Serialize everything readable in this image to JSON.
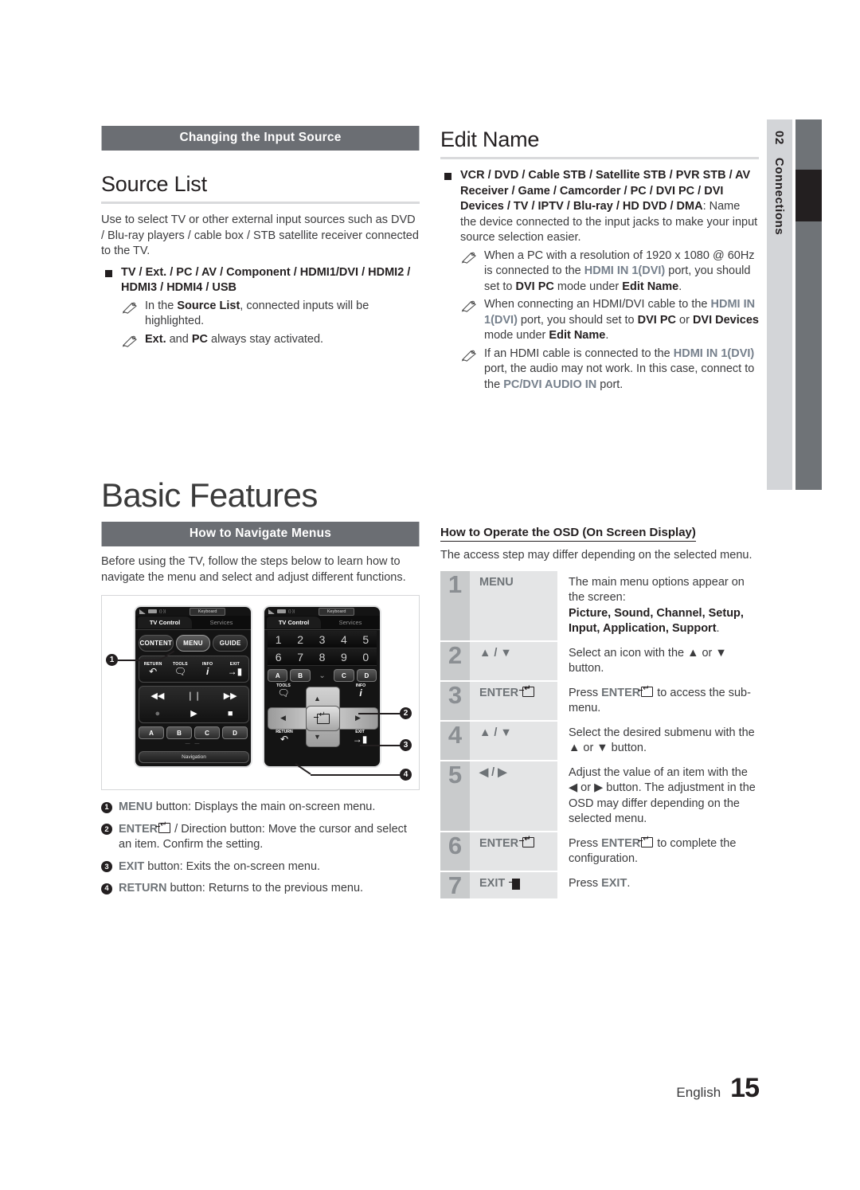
{
  "side_tab": {
    "chapter_number": "02",
    "chapter_title": "Connections"
  },
  "left_column": {
    "section_bar": "Changing the Input Source",
    "heading": "Source List",
    "intro": "Use to select TV or other external input sources such as DVD / Blu-ray players / cable box / STB satellite receiver connected to the TV.",
    "bullet": "TV / Ext. / PC / AV / Component / HDMI1/DVI / HDMI2 / HDMI3 / HDMI4 / USB",
    "notes": [
      {
        "prefix": "In the ",
        "bold1": "Source List",
        "mid": ", connected inputs will be highlighted.",
        "bold2": "",
        "suffix": ""
      },
      {
        "prefix": "",
        "bold1": "Ext.",
        "mid": " and ",
        "bold2": "PC",
        "suffix": " always stay activated."
      }
    ]
  },
  "right_column": {
    "heading": "Edit Name",
    "bullet_bold": "VCR / DVD / Cable STB / Satellite STB / PVR STB / AV Receiver / Game / Camcorder / PC / DVI PC / DVI Devices / TV / IPTV / Blu-ray / HD DVD / DMA",
    "bullet_colon": ":",
    "bullet_rest": "Name the device connected to the input jacks to make your input source selection easier.",
    "notes": [
      {
        "parts": [
          {
            "t": "When a PC with a resolution of 1920 x 1080 @ 60Hz is connected to the ",
            "s": "normal"
          },
          {
            "t": "HDMI IN 1(DVI)",
            "s": "blue"
          },
          {
            "t": " port, you should set to ",
            "s": "normal"
          },
          {
            "t": "DVI PC",
            "s": "bold"
          },
          {
            "t": " mode under ",
            "s": "normal"
          },
          {
            "t": "Edit Name",
            "s": "bold"
          },
          {
            "t": ".",
            "s": "normal"
          }
        ]
      },
      {
        "parts": [
          {
            "t": "When connecting an HDMI/DVI cable to the ",
            "s": "normal"
          },
          {
            "t": "HDMI IN 1(DVI)",
            "s": "blue"
          },
          {
            "t": " port, you should set to ",
            "s": "normal"
          },
          {
            "t": "DVI PC",
            "s": "bold"
          },
          {
            "t": " or ",
            "s": "normal"
          },
          {
            "t": "DVI Devices",
            "s": "bold"
          },
          {
            "t": " mode under ",
            "s": "normal"
          },
          {
            "t": "Edit Name",
            "s": "bold"
          },
          {
            "t": ".",
            "s": "normal"
          }
        ]
      },
      {
        "parts": [
          {
            "t": "If an HDMI cable is connected to the ",
            "s": "normal"
          },
          {
            "t": "HDMI IN 1(DVI)",
            "s": "blue"
          },
          {
            "t": " port, the audio may not work. In this case, connect to the ",
            "s": "normal"
          },
          {
            "t": "PC/DVI AUDIO IN",
            "s": "blue"
          },
          {
            "t": " port.",
            "s": "normal"
          }
        ]
      }
    ]
  },
  "chapter": {
    "title": "Basic Features"
  },
  "navigate_section": {
    "section_bar": "How to Navigate Menus",
    "intro": "Before using the TV, follow the steps below to learn how to navigate the menu and select and adjust different functions."
  },
  "figure": {
    "device_a": {
      "status_keyboard": "Keyboard",
      "tab_active": "TV Control",
      "tab_inactive": "Services",
      "pills": [
        "CONTENT",
        "MENU",
        "GUIDE"
      ],
      "fn_buttons": [
        {
          "label": "RETURN",
          "glyph": "↶"
        },
        {
          "label": "TOOLS",
          "glyph": "➦"
        },
        {
          "label": "INFO",
          "glyph": "i"
        },
        {
          "label": "EXIT",
          "glyph": "→"
        }
      ],
      "media": [
        "◀◀",
        "❘❘",
        "▶▶",
        "●",
        "▶",
        "■"
      ],
      "color_buttons": [
        "A",
        "B",
        "C",
        "D"
      ],
      "pager": "— —",
      "nav_label": "Navigation"
    },
    "device_b": {
      "status_keyboard": "Keyboard",
      "tab_active": "TV Control",
      "tab_inactive": "Services",
      "numbers": [
        "1",
        "2",
        "3",
        "4",
        "5",
        "6",
        "7",
        "8",
        "9",
        "0"
      ],
      "color_buttons": [
        "A",
        "B",
        "C",
        "D"
      ],
      "collapse_glyph": "⌄",
      "tools_label": "TOOLS",
      "tools_glyph": "➦",
      "info_label": "INFO",
      "info_glyph": "i",
      "return_label": "RETURN",
      "return_glyph": "↶",
      "exit_label": "EXIT",
      "exit_glyph": "→",
      "dpad_up": "▲",
      "dpad_down": "▼",
      "dpad_left": "◀",
      "dpad_right": "▶",
      "dpad_center": "↵"
    },
    "callouts": [
      "1",
      "2",
      "3",
      "4"
    ]
  },
  "legend": [
    {
      "num": "❶",
      "key": "MENU",
      "text": " button: Displays the main on-screen menu."
    },
    {
      "num": "❷",
      "key": "ENTER",
      "has_enter_glyph": true,
      "text": " / Direction button: Move the cursor and select an item. Confirm the setting."
    },
    {
      "num": "❸",
      "key": "EXIT",
      "text": " button: Exits the on-screen menu."
    },
    {
      "num": "❹",
      "key": "RETURN",
      "text": " button: Returns to the previous menu."
    }
  ],
  "osd_section": {
    "heading": "How to Operate the OSD (On Screen Display)",
    "intro": "The access step may differ depending on the selected menu.",
    "steps": [
      {
        "num": "1",
        "key": "MENU",
        "key_glyph": "none",
        "desc_normal": "The main menu options appear on the screen:",
        "desc_bold": "Picture, Sound, Channel, Setup, Input, Application, Support",
        "desc_tail": "."
      },
      {
        "num": "2",
        "key": "▲ / ▼",
        "key_glyph": "none",
        "desc_normal": "Select an icon with the ▲ or ▼ button.",
        "desc_bold": "",
        "desc_tail": ""
      },
      {
        "num": "3",
        "key": "ENTER",
        "key_glyph": "enter",
        "desc_pre": "Press ",
        "desc_key": "ENTER",
        "desc_post": " to access the sub-menu."
      },
      {
        "num": "4",
        "key": "▲ / ▼",
        "key_glyph": "none",
        "desc_normal": "Select the desired submenu with the ▲ or ▼ button.",
        "desc_bold": "",
        "desc_tail": ""
      },
      {
        "num": "5",
        "key": "◀ / ▶",
        "key_glyph": "none",
        "desc_normal": "Adjust the value of an item with the ◀ or ▶ button. The adjustment in the OSD may differ depending on the selected menu.",
        "desc_bold": "",
        "desc_tail": ""
      },
      {
        "num": "6",
        "key": "ENTER",
        "key_glyph": "enter",
        "desc_pre": "Press ",
        "desc_key": "ENTER",
        "desc_post": " to complete the configuration."
      },
      {
        "num": "7",
        "key": "EXIT",
        "key_glyph": "exit",
        "desc_pre": "Press ",
        "desc_key": "EXIT",
        "desc_post": "."
      }
    ]
  },
  "footer": {
    "language": "English",
    "page_number": "15"
  },
  "colors": {
    "bar_gray": "#6b6e73",
    "side_tab_gray": "#d3d5d8",
    "side_bar_gray": "#6f7377",
    "side_bar_active": "#231f20",
    "accent_blue_gray": "#76808c",
    "table_num_bg": "#c9cbcc",
    "table_key_bg": "#e4e5e6"
  }
}
